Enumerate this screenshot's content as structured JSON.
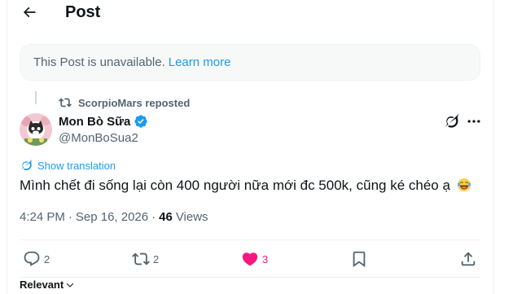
{
  "header": {
    "title": "Post"
  },
  "notice": {
    "text": "This Post is unavailable.",
    "link": "Learn more"
  },
  "repost": {
    "text": "ScorpioMars reposted"
  },
  "author": {
    "name": "Mon Bò Sữa",
    "handle": "@MonBoSua2"
  },
  "translation": {
    "label": "Show translation"
  },
  "post": {
    "text": "Mình chết đi sống lại còn 400 người nữa mới đc 500k, cũng ké chéo ạ",
    "emoji": "face-with-tears-of-joy"
  },
  "meta": {
    "time": "4:24 PM",
    "separator": "·",
    "date": "Sep 16, 2026",
    "views_count": "46",
    "views_label": "Views"
  },
  "actions": {
    "replies": "2",
    "reposts": "2",
    "likes": "3"
  },
  "replies_sort": {
    "label": "Relevant"
  },
  "colors": {
    "accent": "#1d9bf0",
    "like": "#f91880",
    "muted": "#536471",
    "text": "#0f1419"
  }
}
